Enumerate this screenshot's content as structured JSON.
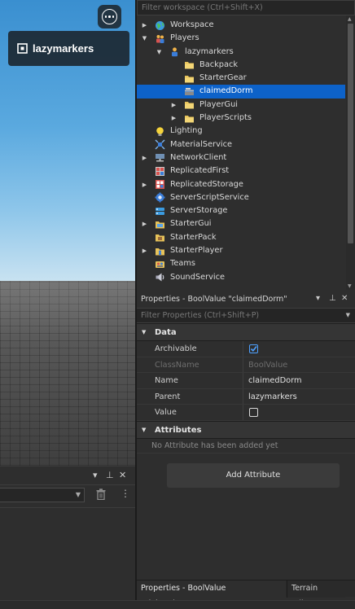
{
  "viewport": {
    "username": "lazymarkers",
    "more_icon": "more-ellipsis-icon",
    "logo_icon": "roblox-logo-icon"
  },
  "explorer": {
    "filter_placeholder": "Filter workspace (Ctrl+Shift+X)",
    "items": [
      {
        "label": "Workspace",
        "icon": "workspace-globe-icon",
        "expander": "collapsed"
      },
      {
        "label": "Players",
        "icon": "players-icon",
        "expander": "expanded"
      },
      {
        "label": "lazymarkers",
        "icon": "player-icon",
        "expander": "expanded"
      },
      {
        "label": "Backpack",
        "icon": "folder-icon",
        "expander": ""
      },
      {
        "label": "StarterGear",
        "icon": "folder-icon",
        "expander": ""
      },
      {
        "label": "claimedDorm",
        "icon": "bool-value-icon",
        "expander": "",
        "selected": true
      },
      {
        "label": "PlayerGui",
        "icon": "folder-icon",
        "expander": "collapsed"
      },
      {
        "label": "PlayerScripts",
        "icon": "folder-icon",
        "expander": "collapsed"
      },
      {
        "label": "Lighting",
        "icon": "lighting-bulb-icon",
        "expander": ""
      },
      {
        "label": "MaterialService",
        "icon": "material-service-icon",
        "expander": ""
      },
      {
        "label": "NetworkClient",
        "icon": "network-icon",
        "expander": "collapsed"
      },
      {
        "label": "ReplicatedFirst",
        "icon": "replicated-first-icon",
        "expander": ""
      },
      {
        "label": "ReplicatedStorage",
        "icon": "replicated-storage-icon",
        "expander": "collapsed"
      },
      {
        "label": "ServerScriptService",
        "icon": "server-script-service-icon",
        "expander": ""
      },
      {
        "label": "ServerStorage",
        "icon": "server-storage-icon",
        "expander": ""
      },
      {
        "label": "StarterGui",
        "icon": "starter-gui-icon",
        "expander": "collapsed"
      },
      {
        "label": "StarterPack",
        "icon": "starter-pack-icon",
        "expander": ""
      },
      {
        "label": "StarterPlayer",
        "icon": "starter-player-icon",
        "expander": "collapsed"
      },
      {
        "label": "Teams",
        "icon": "teams-icon",
        "expander": ""
      },
      {
        "label": "SoundService",
        "icon": "sound-service-icon",
        "expander": ""
      }
    ]
  },
  "properties": {
    "title": "Properties - BoolValue \"claimedDorm\"",
    "filter_placeholder": "Filter Properties (Ctrl+Shift+P)",
    "data_section": "Data",
    "rows": [
      {
        "key": "Archivable",
        "type": "checkbox",
        "checked": true
      },
      {
        "key": "ClassName",
        "value": "BoolValue",
        "dim": true
      },
      {
        "key": "Name",
        "value": "claimedDorm"
      },
      {
        "key": "Parent",
        "value": "lazymarkers"
      },
      {
        "key": "Value",
        "type": "checkbox",
        "checked": false
      }
    ],
    "attributes_section": "Attributes",
    "no_attributes": "No Attribute has been added yet",
    "add_attribute_label": "Add Attribute"
  },
  "tabs": [
    {
      "label": "Properties - BoolValue \"claimedDorm\"",
      "active": true
    },
    {
      "label": "Terrain Editor",
      "active": false
    }
  ],
  "colors": {
    "selection": "#0d62c9",
    "panel_bg": "#2e2e2e",
    "accent_check": "#4ea1ff"
  }
}
